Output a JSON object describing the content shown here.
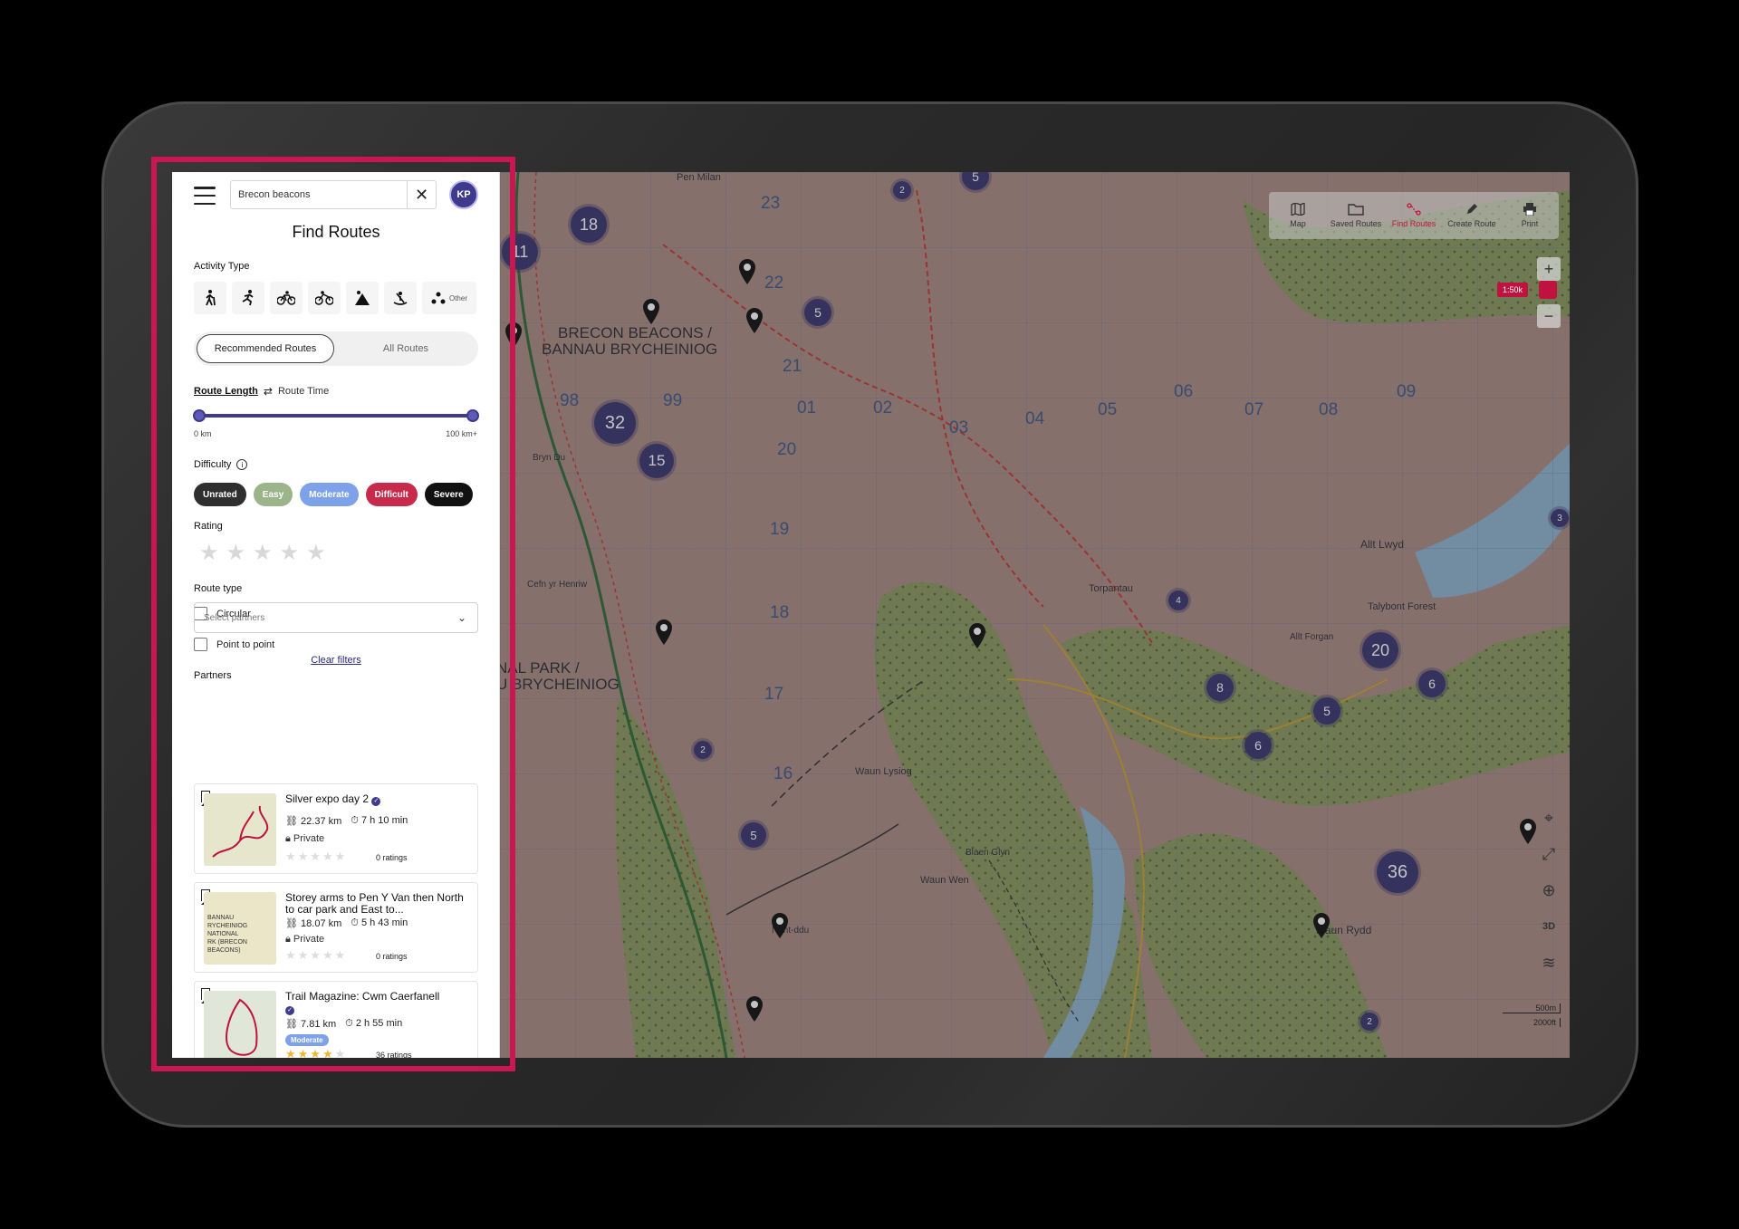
{
  "search": {
    "value": "Brecon beacons"
  },
  "user": {
    "initials": "KP"
  },
  "panel": {
    "title": "Find Routes",
    "activity_type_label": "Activity Type",
    "activities": [
      "walking-icon",
      "running-icon",
      "cycling-icon",
      "mountain-biking-icon",
      "climbing-icon",
      "kayaking-icon"
    ],
    "other_label": "Other",
    "tabs": {
      "recommended": "Recommended Routes",
      "all": "All Routes"
    },
    "route_length_label": "Route Length",
    "route_time_label": "Route Time",
    "range_min": "0 km",
    "range_max": "100 km+",
    "range_fraction": [
      0,
      1
    ],
    "difficulty_label": "Difficulty",
    "difficulties": [
      {
        "label": "Unrated",
        "color": "#2f2f2f"
      },
      {
        "label": "Easy",
        "color": "#9bb48a"
      },
      {
        "label": "Moderate",
        "color": "#7ea2ea"
      },
      {
        "label": "Difficult",
        "color": "#c72a4b"
      },
      {
        "label": "Severe",
        "color": "#111111"
      }
    ],
    "rating_label": "Rating",
    "route_type_label": "Route type",
    "route_types": [
      "Circular",
      "Point to point"
    ],
    "partners_label": "Partners",
    "partners_placeholder": "Select partners",
    "clear_filters": "Clear filters"
  },
  "routes": [
    {
      "title": "Silver expo day 2",
      "distance": "22.37 km",
      "time": "7 h 10 min",
      "visibility": "Private",
      "ratings": "0 ratings",
      "stars": 0
    },
    {
      "title": "Storey arms to Pen Y Van then North to car park and East to...",
      "distance": "18.07 km",
      "time": "5 h 43 min",
      "visibility": "Private",
      "ratings": "0 ratings",
      "stars": 0,
      "thumb_text": [
        "BANNAU",
        "RYCHEINIOG",
        "NATIONAL",
        "RK (BRECON",
        "BEACONS)"
      ]
    },
    {
      "title": "Trail Magazine: Cwm Caerfanell",
      "distance": "7.81 km",
      "time": "2 h 55 min",
      "badge": "Moderate",
      "ratings": "36 ratings",
      "stars": 4
    }
  ],
  "toolbar": [
    {
      "label": "Map",
      "icon": "map-icon"
    },
    {
      "label": "Saved Routes",
      "icon": "folder-icon"
    },
    {
      "label": "Find Routes",
      "icon": "route-icon",
      "active": true
    },
    {
      "label": "Create Route",
      "icon": "pencil-icon"
    },
    {
      "label": "Print",
      "icon": "print-icon"
    }
  ],
  "map": {
    "scale_ratio": "1:50k",
    "scale_km": "500m",
    "scale_ft": "2000ft",
    "labels": [
      "BRECON BEACONS /",
      "BANNAU BRYCHEINIOG",
      "NAL PARK /",
      "U BRYCHEINIOG",
      "Pen Milan",
      "Torpantau",
      "Allt Lwyd",
      "Waun Rydd",
      "Talybont Forest",
      "Waun Wen",
      "Waun Lysiog",
      "Nant-ddu",
      "Blaen Glyn",
      "Cefn yr Henriw",
      "Bryn Du",
      "Allt Forgan"
    ],
    "grid_numbers": [
      "23",
      "22",
      "21",
      "01",
      "02",
      "03",
      "04",
      "05",
      "06",
      "07",
      "08",
      "09",
      "99",
      "98",
      "20",
      "19",
      "18",
      "17",
      "16"
    ],
    "clusters": [
      "18",
      "11",
      "5",
      "32",
      "15",
      "2",
      "5",
      "4",
      "20",
      "6",
      "8",
      "5",
      "6",
      "36",
      "2",
      "5",
      "2",
      "3"
    ],
    "controls": {
      "zoom_in": "+",
      "zoom_out": "−",
      "three_d": "3D"
    }
  }
}
